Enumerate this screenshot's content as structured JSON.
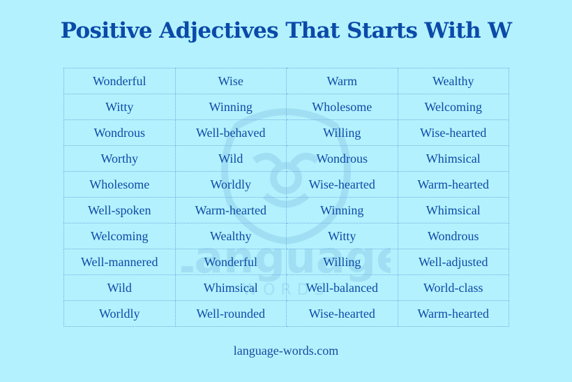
{
  "title": "Positive Adjectives That Starts With W",
  "watermark": {
    "text": "Language",
    "subtext": "WORDS"
  },
  "table": {
    "rows": [
      [
        "Wonderful",
        "Wise",
        "Warm",
        "Wealthy"
      ],
      [
        "Witty",
        "Winning",
        "Wholesome",
        "Welcoming"
      ],
      [
        "Wondrous",
        "Well-behaved",
        "Willing",
        "Wise-hearted"
      ],
      [
        "Worthy",
        "Wild",
        "Wondrous",
        "Whimsical"
      ],
      [
        "Wholesome",
        "Worldly",
        "Wise-hearted",
        "Warm-hearted"
      ],
      [
        "Well-spoken",
        "Warm-hearted",
        "Winning",
        "Whimsical"
      ],
      [
        "Welcoming",
        "Wealthy",
        "Witty",
        "Wondrous"
      ],
      [
        "Well-mannered",
        "Wonderful",
        "Willing",
        "Well-adjusted"
      ],
      [
        "Wild",
        "Whimsical",
        "Well-balanced",
        "World-class"
      ],
      [
        "Worldly",
        "Well-rounded",
        "Wise-hearted",
        "Warm-hearted"
      ]
    ]
  },
  "footer": "language-words.com",
  "colors": {
    "background": "#b3f1fe",
    "title": "#0b4aa8",
    "text": "#0f4aa6",
    "border": "#6fb0e0"
  }
}
